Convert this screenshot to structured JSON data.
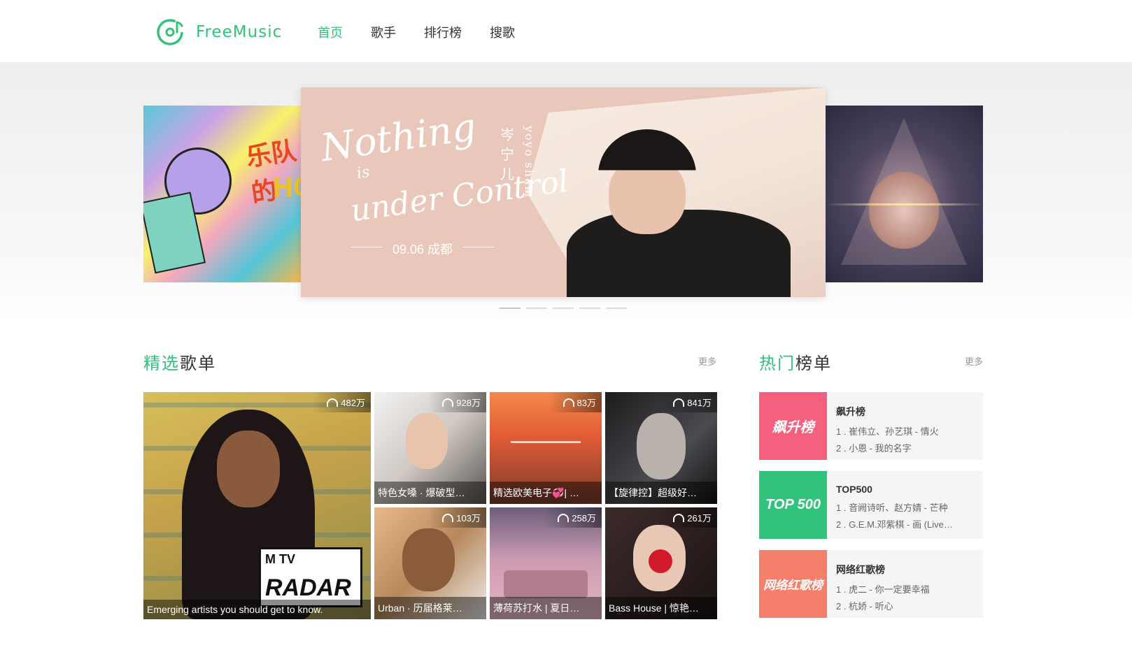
{
  "header": {
    "logo_text": "FreeMusic",
    "nav": [
      "首页",
      "歌手",
      "排行榜",
      "搜歌"
    ],
    "active_nav": "首页"
  },
  "banner": {
    "center": {
      "title_line1": "Nothing",
      "title_line2": "is",
      "title_line3": "under Control",
      "artist_cn": "岑宁儿",
      "artist_en": "yoyo sham",
      "date": "09.06 成都"
    },
    "left": {
      "text1": "乐队的",
      "text2": "HO"
    },
    "dots_count": 5,
    "active_dot": 0
  },
  "featured": {
    "title_green": "精选",
    "title_rest": "歌单",
    "more": "更多",
    "playlists": [
      {
        "name": "Emerging artists you should get to know.",
        "plays": "482万",
        "color": "#d4b254"
      },
      {
        "name": "特色女嗓 · 爆破型…",
        "plays": "928万",
        "color": "#c9c2bc"
      },
      {
        "name": "精选欧美电子💞| …",
        "plays": "83万",
        "color": "#d9693d"
      },
      {
        "name": "【旋律控】超级好…",
        "plays": "841万",
        "color": "#2f2f33"
      },
      {
        "name": "Urban · 历届格莱…",
        "plays": "103万",
        "color": "#c39a6f"
      },
      {
        "name": "薄荷苏打水 | 夏日…",
        "plays": "258万",
        "color": "#b58aa0"
      },
      {
        "name": "Bass House | 惊艳…",
        "plays": "261万",
        "color": "#3a2b2e"
      }
    ],
    "radar_badge": "RADAR",
    "mtv": "M TV"
  },
  "hot": {
    "title_green": "热门",
    "title_rest": "榜单",
    "more": "更多",
    "lists": [
      {
        "cover": "飙升榜",
        "color": "#f4617e",
        "name": "飙升榜",
        "songs": [
          "1 . 崔伟立、孙艺琪 - 情火",
          "2 . 小恩 - 我的名字"
        ]
      },
      {
        "cover": "TOP 500",
        "color": "#31c27c",
        "name": "TOP500",
        "songs": [
          "1 . 音阙诗听、赵方婧 - 芒种",
          "2 . G.E.M.邓紫棋 - 画 (Live…"
        ]
      },
      {
        "cover": "网络红歌榜",
        "color": "#f57f6b",
        "name": "网络红歌榜",
        "songs": [
          "1 . 虎二 - 你一定要幸福",
          "2 . 杭娇 - 听心"
        ]
      }
    ]
  },
  "icons": {
    "logo": "music-disc-icon",
    "plays": "headphones-icon"
  },
  "colors": {
    "accent": "#31c27c"
  }
}
